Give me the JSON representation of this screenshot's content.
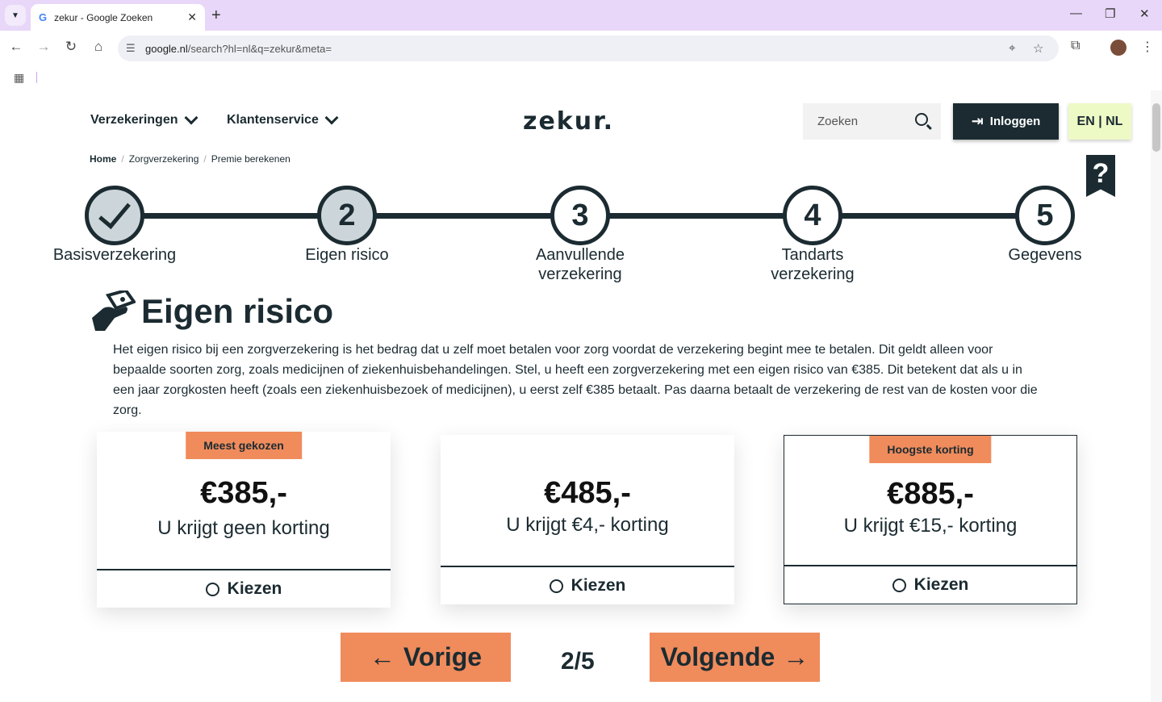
{
  "browser": {
    "tab_title": "zekur - Google Zoeken",
    "tab_favicon": "G",
    "tab_close": "✕",
    "new_tab": "+",
    "url_domain": "google.nl",
    "url_path": "/search?hl=nl&q=zekur&meta=",
    "win_min": "—",
    "win_restore": "❐",
    "win_close": "✕"
  },
  "site": {
    "nav": [
      "Verzekeringen",
      "Klantenservice"
    ],
    "logo": "zekur.",
    "search_placeholder": "Zoeken",
    "login_label": "Inloggen",
    "lang_label": "EN | NL",
    "help_label": "?"
  },
  "breadcrumb": [
    "Home",
    "Zorgverzekering",
    "Premie berekenen"
  ],
  "steps": [
    {
      "number": "",
      "label": "Basisverzekering",
      "state": "done"
    },
    {
      "number": "2",
      "label": "Eigen risico",
      "state": "current"
    },
    {
      "number": "3",
      "label": "Aanvullende verzekering",
      "state": "todo"
    },
    {
      "number": "4",
      "label": "Tandarts verzekering",
      "state": "todo"
    },
    {
      "number": "5",
      "label": "Gegevens",
      "state": "todo"
    }
  ],
  "heading": "Eigen risico",
  "intro": "Het eigen risico bij een zorgverzekering is het bedrag dat u zelf moet betalen voor zorg voordat de verzekering begint mee te betalen. Dit geldt alleen voor bepaalde soorten zorg, zoals medicijnen of ziekenhuisbehandelingen. Stel, u heeft een zorgverzekering met een eigen risico van €385. Dit betekent dat als u in een jaar zorgkosten heeft (zoals een ziekenhuisbezoek of medicijnen), u eerst zelf €385 betaalt. Pas daarna betaalt de verzekering de rest van de kosten voor die zorg.",
  "options": [
    {
      "badge": "Meest gekozen",
      "price": "€385,-",
      "discount": "U krijgt geen korting",
      "choose": "Kiezen"
    },
    {
      "badge": "",
      "price": "€485,-",
      "discount": "U krijgt €4,- korting",
      "choose": "Kiezen"
    },
    {
      "badge": "Hoogste korting",
      "price": "€885,-",
      "discount": "U krijgt €15,- korting",
      "choose": "Kiezen"
    }
  ],
  "pager": {
    "prev": "Vorige",
    "next": "Volgende",
    "counter": "2/5"
  },
  "colors": {
    "brand_dark": "#1b2b31",
    "accent": "#f08b5c",
    "lang_bg": "#eefac6"
  }
}
